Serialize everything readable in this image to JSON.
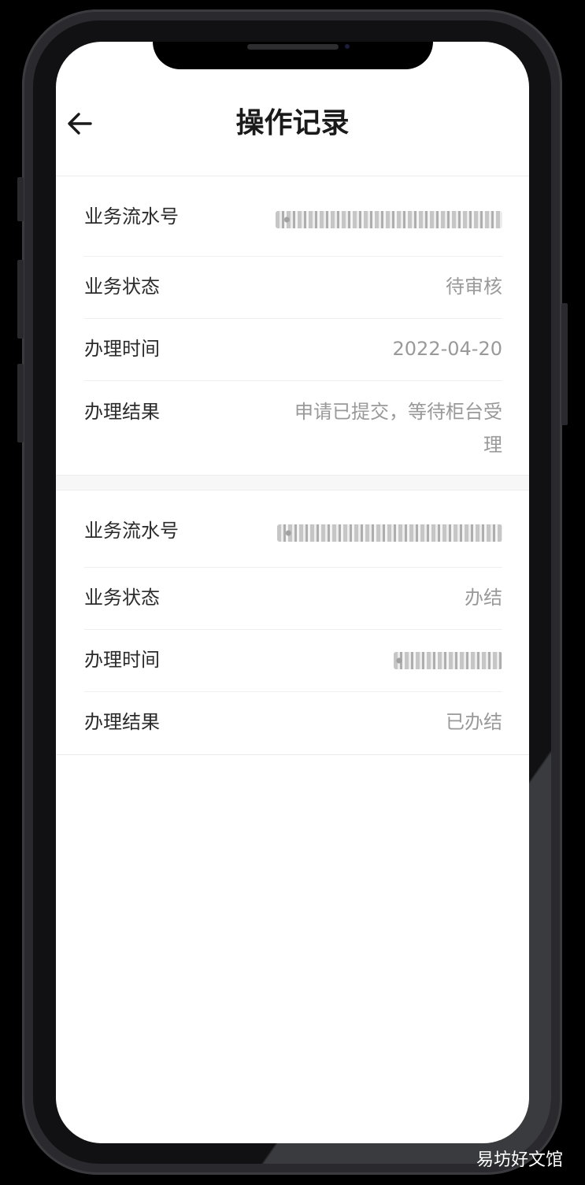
{
  "header": {
    "title": "操作记录",
    "back_icon": "arrow-left-icon"
  },
  "records": [
    {
      "fields": [
        {
          "label": "业务流水号",
          "value": "",
          "masked": true
        },
        {
          "label": "业务状态",
          "value": "待审核"
        },
        {
          "label": "办理时间",
          "value": "2022-04-20"
        },
        {
          "label": "办理结果",
          "value": "申请已提交，等待柜台受理"
        }
      ]
    },
    {
      "fields": [
        {
          "label": "业务流水号",
          "value": "",
          "masked": true
        },
        {
          "label": "业务状态",
          "value": "办结"
        },
        {
          "label": "办理时间",
          "value": "",
          "masked": true
        },
        {
          "label": "办理结果",
          "value": "已办结"
        }
      ]
    }
  ],
  "watermark": "易坊好文馆",
  "colors": {
    "background": "#ffffff",
    "label_text": "#2b2b2b",
    "value_text": "#999999",
    "divider": "#eeeeee",
    "frame": "#2a2a2e"
  }
}
